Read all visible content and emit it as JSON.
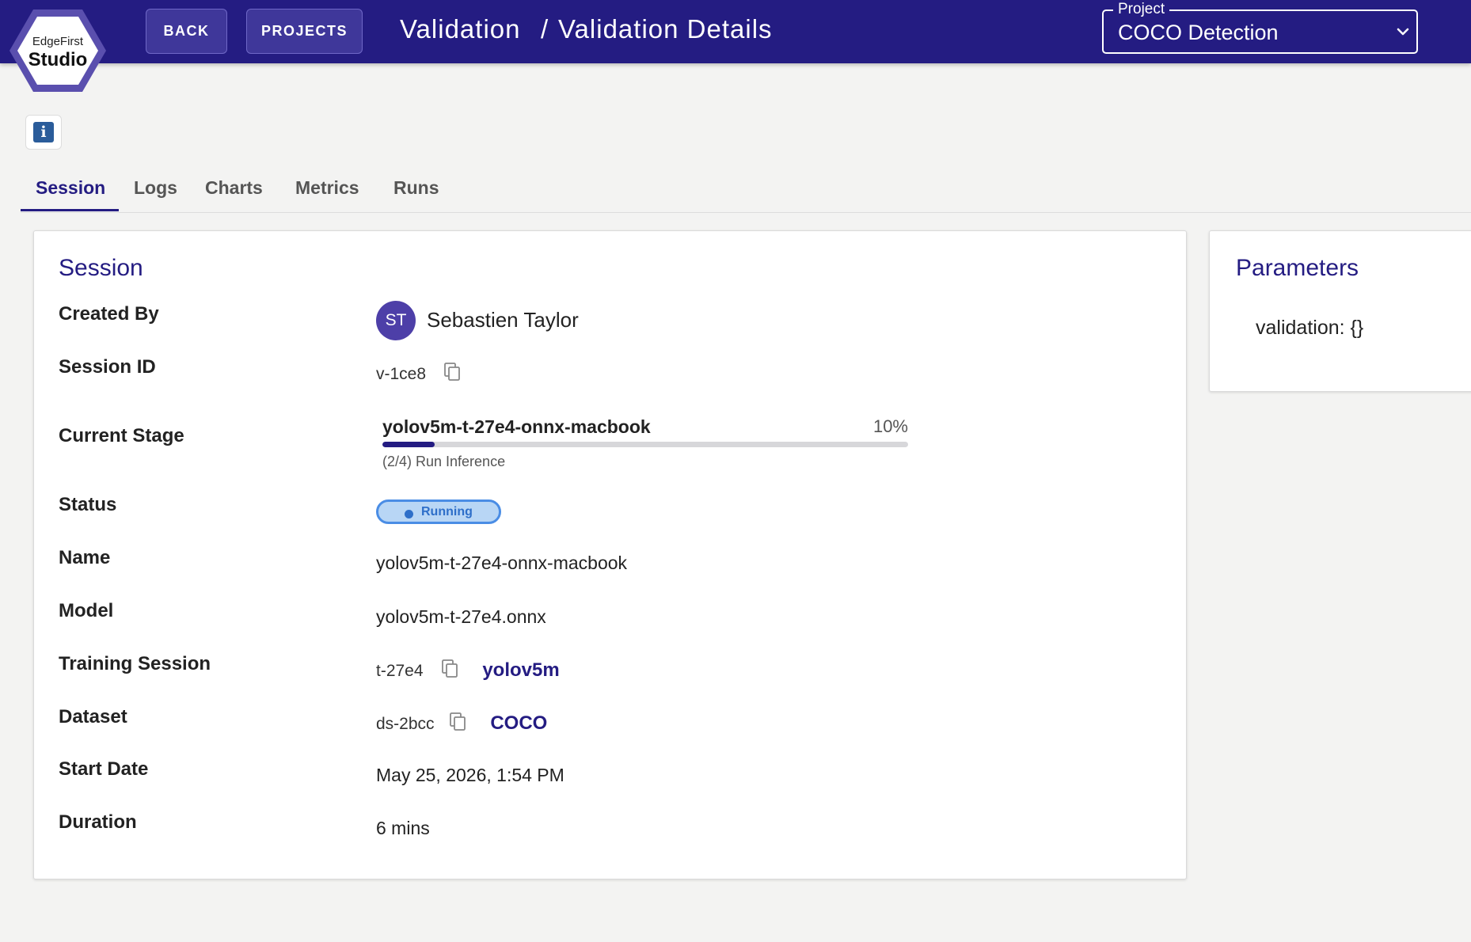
{
  "logo": {
    "small_text": "EdgeFirst",
    "big_text": "Studio"
  },
  "nav": {
    "back_label": "BACK",
    "projects_label": "PROJECTS"
  },
  "breadcrumb": {
    "first": "Validation",
    "separator": "/",
    "second": "Validation Details"
  },
  "project_select": {
    "label": "Project",
    "value": "COCO Detection"
  },
  "tabs": [
    {
      "label": "Session",
      "active": true
    },
    {
      "label": "Logs"
    },
    {
      "label": "Charts"
    },
    {
      "label": "Metrics"
    },
    {
      "label": "Runs"
    }
  ],
  "session": {
    "title": "Session",
    "labels": {
      "created_by": "Created By",
      "session_id": "Session ID",
      "current_stage": "Current Stage",
      "status": "Status",
      "name": "Name",
      "model": "Model",
      "training_session": "Training Session",
      "dataset": "Dataset",
      "start_date": "Start Date",
      "duration": "Duration"
    },
    "created_by": {
      "initials": "ST",
      "name": "Sebastien Taylor"
    },
    "session_id": "v-1ce8",
    "current_stage": {
      "name": "yolov5m-t-27e4-onnx-macbook",
      "progress_text": "10%",
      "progress_fraction": 0.1,
      "step": "(2/4) Run Inference"
    },
    "status": "Running",
    "name": "yolov5m-t-27e4-onnx-macbook",
    "model": "yolov5m-t-27e4.onnx",
    "training_session": {
      "id": "t-27e4",
      "link": "yolov5m"
    },
    "dataset": {
      "id": "ds-2bcc",
      "link": "COCO"
    },
    "start_date": "May 25, 2026, 1:54 PM",
    "duration": "6 mins"
  },
  "parameters": {
    "title": "Parameters",
    "body": "validation: {}"
  },
  "colors": {
    "primary": "#241c82",
    "status_blue": "#2e6fc9",
    "avatar": "#4d3fa8"
  },
  "icons": [
    "info-icon",
    "copy-icon",
    "chevron-down-icon"
  ]
}
